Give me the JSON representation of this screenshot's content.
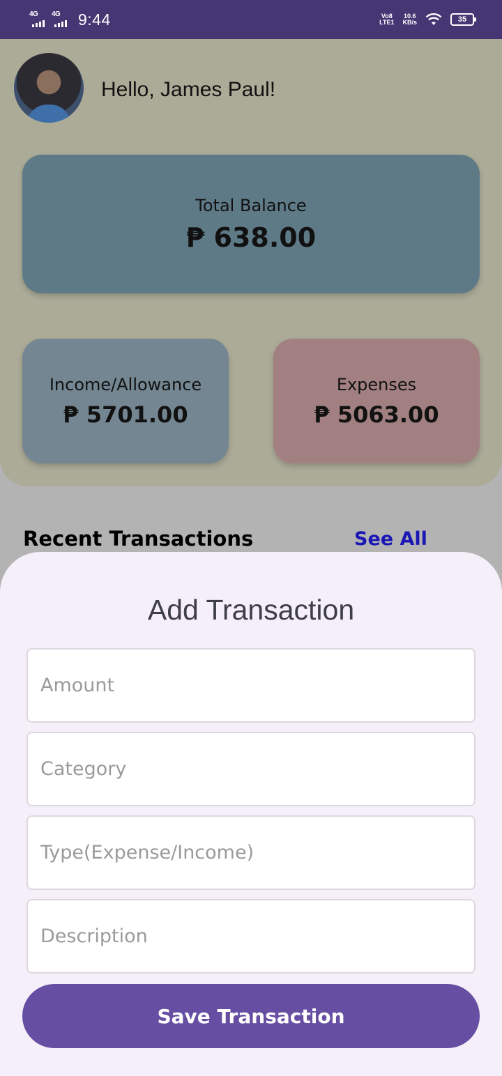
{
  "status_bar": {
    "net1": "4G",
    "net2": "4G",
    "time": "9:44",
    "volte_top": "Vo8",
    "volte_bottom": "LTE1",
    "speed_top": "10.6",
    "speed_bottom": "KB/s",
    "battery": "35"
  },
  "header": {
    "greeting": "Hello, James Paul!"
  },
  "balance": {
    "label": "Total Balance",
    "amount": "₱ 638.00"
  },
  "income": {
    "label": "Income/Allowance",
    "amount": "₱ 5701.00"
  },
  "expenses": {
    "label": "Expenses",
    "amount": "₱ 5063.00"
  },
  "recent": {
    "title": "Recent Transactions",
    "see_all": "See All"
  },
  "sheet": {
    "title": "Add Transaction",
    "amount_placeholder": "Amount",
    "category_placeholder": "Category",
    "type_placeholder": "Type(Expense/Income)",
    "description_placeholder": "Description",
    "save_label": "Save Transaction"
  },
  "colors": {
    "status_bar": "#463774",
    "header_bg": "#acab98",
    "total_card": "#5f7a87",
    "income_card": "#738691",
    "expense_card": "#a28081",
    "see_all": "#1a17b5",
    "sheet_bg": "#f4eff8",
    "save_button": "#664ea2"
  }
}
